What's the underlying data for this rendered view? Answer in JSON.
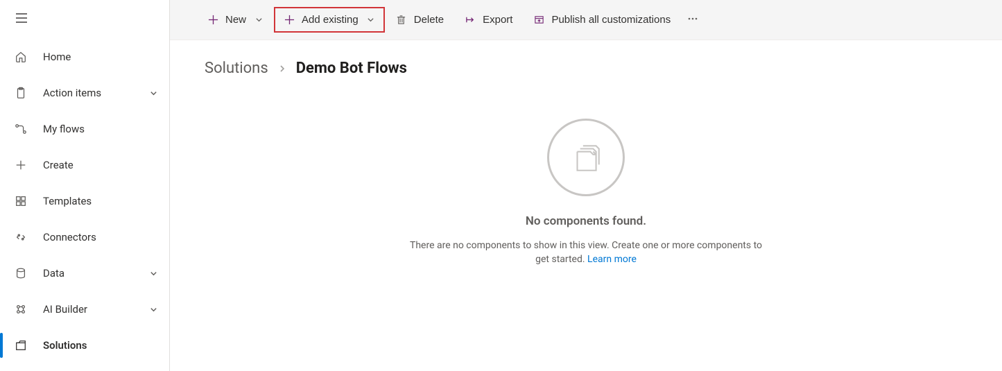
{
  "sidebar": {
    "items": [
      {
        "label": "Home",
        "icon": "home",
        "chevron": false,
        "selected": false
      },
      {
        "label": "Action items",
        "icon": "clipboard",
        "chevron": true,
        "selected": false
      },
      {
        "label": "My flows",
        "icon": "flow",
        "chevron": false,
        "selected": false
      },
      {
        "label": "Create",
        "icon": "plus",
        "chevron": false,
        "selected": false
      },
      {
        "label": "Templates",
        "icon": "templates",
        "chevron": false,
        "selected": false
      },
      {
        "label": "Connectors",
        "icon": "connector",
        "chevron": false,
        "selected": false
      },
      {
        "label": "Data",
        "icon": "database",
        "chevron": true,
        "selected": false
      },
      {
        "label": "AI Builder",
        "icon": "ai",
        "chevron": true,
        "selected": false
      },
      {
        "label": "Solutions",
        "icon": "solutions",
        "chevron": false,
        "selected": true
      }
    ]
  },
  "toolbar": {
    "new_label": "New",
    "add_existing_label": "Add existing",
    "delete_label": "Delete",
    "export_label": "Export",
    "publish_label": "Publish all customizations"
  },
  "breadcrumb": {
    "root": "Solutions",
    "current": "Demo Bot Flows"
  },
  "empty": {
    "title": "No components found.",
    "text": "There are no components to show in this view. Create one or more components to get started.",
    "link": "Learn more"
  }
}
